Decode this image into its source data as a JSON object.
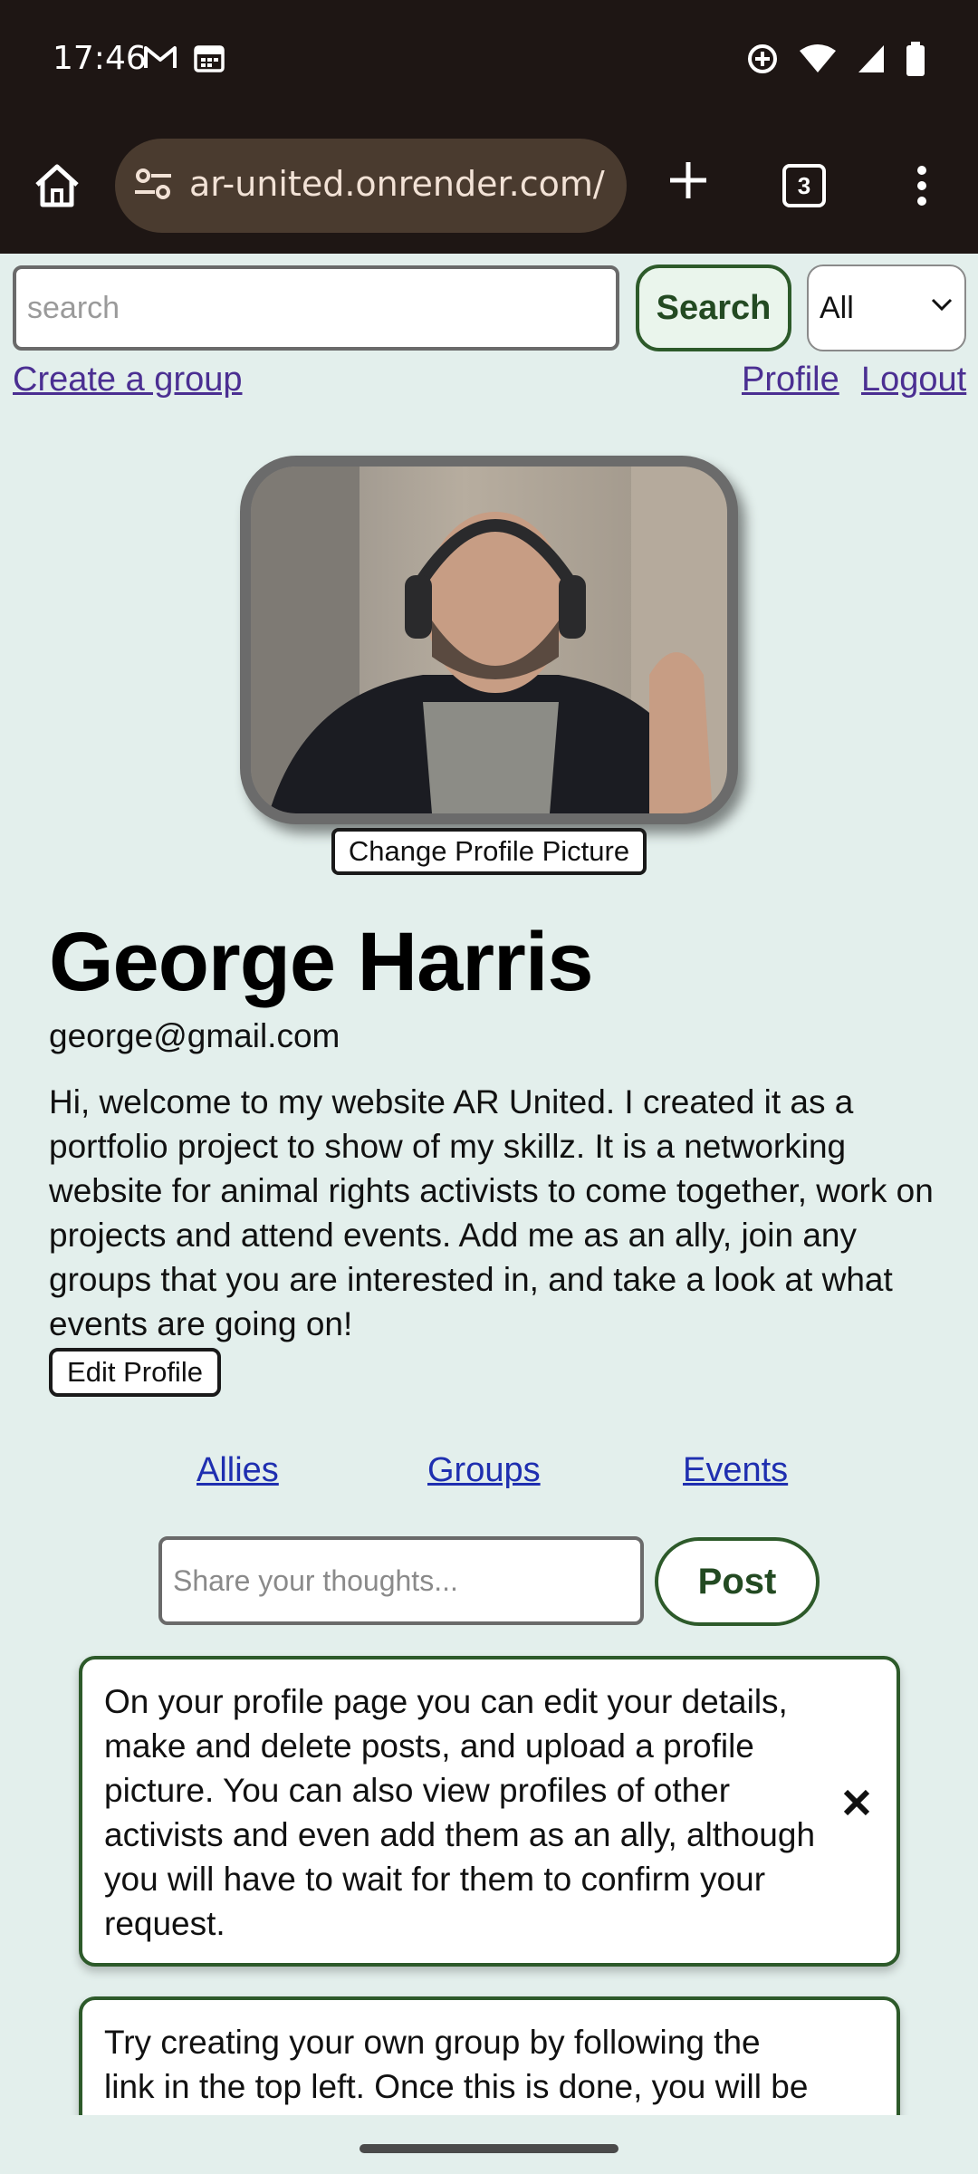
{
  "status_bar": {
    "time": "17:46",
    "left_icons": [
      "gmail-icon",
      "calendar-icon"
    ],
    "right_icons": [
      "data-saver-icon",
      "wifi-icon",
      "signal-icon",
      "battery-icon"
    ]
  },
  "browser": {
    "url": "ar-united.onrender.com/",
    "tab_count": "3"
  },
  "header": {
    "search_placeholder": "search",
    "search_button": "Search",
    "filter_selected": "All",
    "create_group_link": "Create a group",
    "profile_link": "Profile",
    "logout_link": "Logout"
  },
  "profile": {
    "change_picture_button": "Change Profile Picture",
    "name": "George Harris",
    "email": "george@gmail.com",
    "bio": "Hi, welcome to my website AR United. I created it as a portfolio project to show of my skillz. It is a networking website for animal rights activists to come together, work on projects and attend events. Add me as an ally, join any groups that you are interested in, and take a look at what events are going on!",
    "edit_profile_button": "Edit Profile"
  },
  "tabs": {
    "allies": "Allies",
    "groups": "Groups",
    "events": "Events"
  },
  "composer": {
    "placeholder": "Share your thoughts...",
    "post_button": "Post"
  },
  "posts": [
    {
      "text": "On your profile page you can edit your details, make and delete posts, and upload a profile picture. You can also view profiles of other activists and even add them as an ally, although you will have to wait for them to confirm your request."
    },
    {
      "text": "Try creating your own group by following the link in the top left. Once this is done, you will be the admin of that group and other activists will be"
    }
  ],
  "colors": {
    "page_background": "#e3efec",
    "accent_green": "#2d5a2a",
    "link_purple": "#4b2f92",
    "link_blue": "#1f2fb0",
    "browser_chrome": "#1e1614"
  }
}
